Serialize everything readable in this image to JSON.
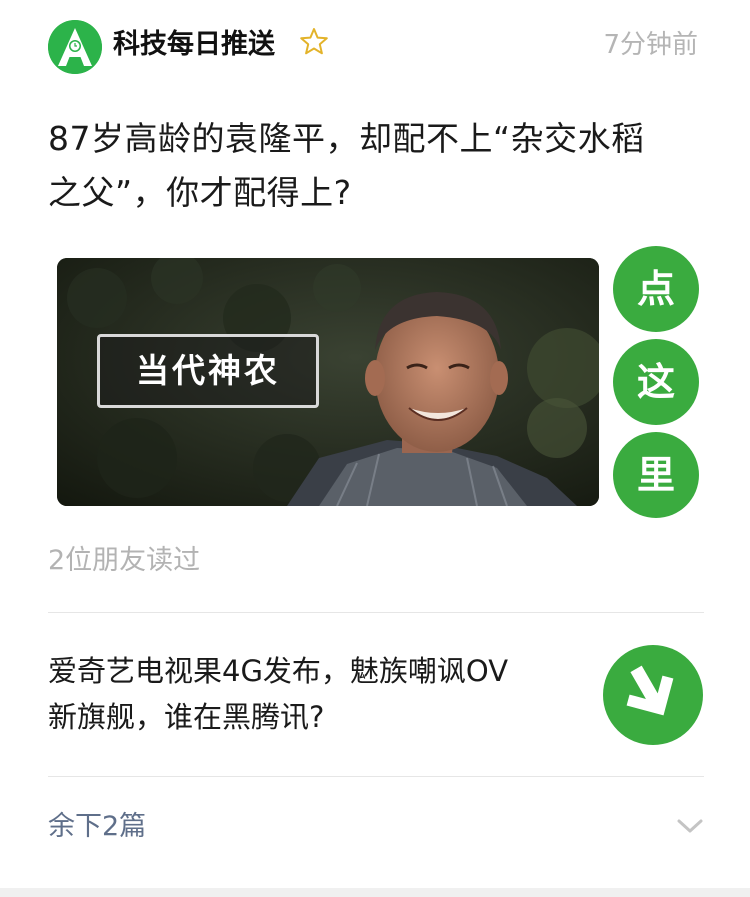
{
  "header": {
    "account_name": "科技每日推送",
    "timestamp": "7分钟前",
    "avatar_icon": "app-logo-icon",
    "star_icon": "star-outline-icon"
  },
  "article": {
    "headline_line1": "87岁高龄的袁隆平，却配不上“杂交水稻",
    "headline_line2": "之父”，你才配得上?",
    "cover_tag": "当代神农",
    "badges": [
      "点",
      "这",
      "里"
    ],
    "read_by": "2位朋友读过"
  },
  "item2": {
    "title_line1": "爱奇艺电视果4G发布，魅族嘲讽OV",
    "title_line2": "新旗舰，谁在黑腾讯?",
    "thumb_icon": "down-arrow-icon"
  },
  "footer": {
    "more_label": "余下2篇",
    "chevron_icon": "chevron-down-icon"
  },
  "colors": {
    "brand_green": "#3aab3f",
    "muted_text": "#b3b3b3",
    "link_text": "#5f6f8a"
  }
}
